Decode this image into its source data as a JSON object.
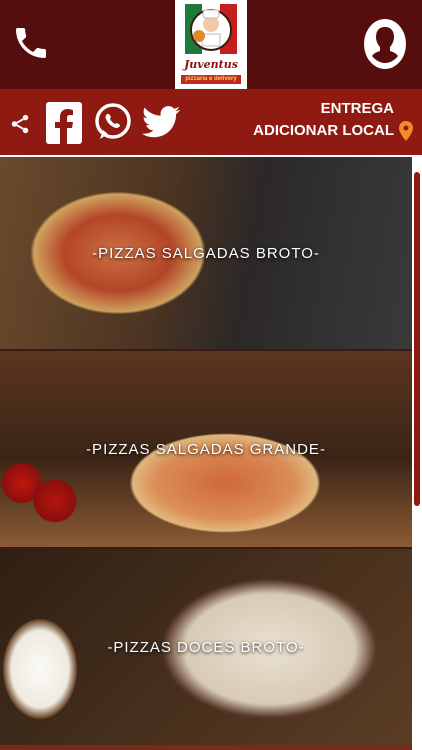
{
  "header": {
    "logo_text": "Juventus",
    "logo_sub": "pizzaria e delivery"
  },
  "socialbar": {
    "entrega_label": "ENTREGA",
    "local_label": "ADICIONAR LOCAL",
    "icons": [
      "share-icon",
      "facebook-icon",
      "whatsapp-icon",
      "twitter-icon",
      "location-pin-icon"
    ]
  },
  "categories": [
    {
      "label": "-PIZZAS SALGADAS BROTO-"
    },
    {
      "label": "-PIZZAS SALGADAS GRANDE-"
    },
    {
      "label": "-PIZZAS DOCES BROTO-"
    }
  ],
  "colors": {
    "topbar": "#560d0d",
    "socialbar": "#8e1a12",
    "pin": "#f28c28"
  }
}
